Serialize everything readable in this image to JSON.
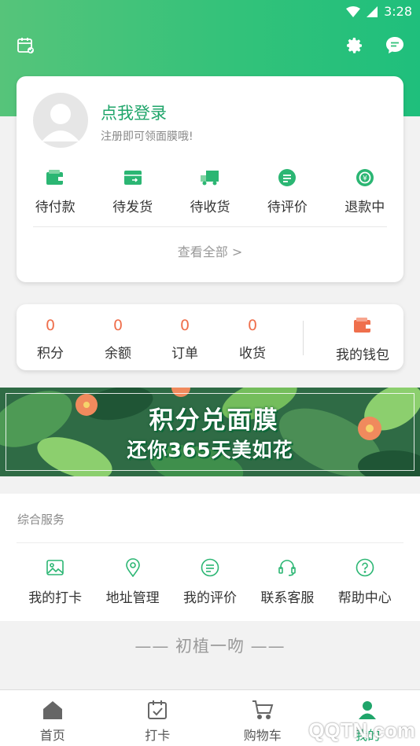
{
  "status_bar": {
    "time": "3:28"
  },
  "header": {
    "icons": [
      "calendar-check-icon",
      "settings-gear-icon",
      "message-bubble-icon"
    ],
    "gradient_colors": [
      "#56c47a",
      "#1fbf7c"
    ]
  },
  "profile": {
    "login_title": "点我登录",
    "login_subtitle": "注册即可领面膜哦!"
  },
  "orders": {
    "items": [
      {
        "label": "待付款",
        "icon": "wallet-icon"
      },
      {
        "label": "待发货",
        "icon": "shipping-box-icon"
      },
      {
        "label": "待收货",
        "icon": "truck-icon"
      },
      {
        "label": "待评价",
        "icon": "comment-icon"
      },
      {
        "label": "退款中",
        "icon": "refund-icon"
      }
    ],
    "view_all": "查看全部 >"
  },
  "stats": {
    "items": [
      {
        "value": "0",
        "label": "积分"
      },
      {
        "value": "0",
        "label": "余额"
      },
      {
        "value": "0",
        "label": "订单"
      },
      {
        "value": "0",
        "label": "收货"
      }
    ],
    "wallet_label": "我的钱包",
    "accent": "#ef6f4c"
  },
  "banner": {
    "title": "积分兑面膜",
    "subtitle": "还你365天美如花"
  },
  "services": {
    "title": "综合服务",
    "items": [
      {
        "label": "我的打卡",
        "icon": "image-icon"
      },
      {
        "label": "地址管理",
        "icon": "location-pin-icon"
      },
      {
        "label": "我的评价",
        "icon": "comment-lines-icon"
      },
      {
        "label": "联系客服",
        "icon": "headset-icon"
      },
      {
        "label": "帮助中心",
        "icon": "help-circle-icon"
      }
    ]
  },
  "slogan": "——  初植一吻  ——",
  "tabbar": {
    "items": [
      {
        "label": "首页",
        "icon": "home-icon"
      },
      {
        "label": "打卡",
        "icon": "calendar-check-icon"
      },
      {
        "label": "购物车",
        "icon": "cart-icon"
      },
      {
        "label": "我的",
        "icon": "person-icon"
      }
    ]
  },
  "watermark": "QQTN.com",
  "colors": {
    "brand_green": "#1fa56a",
    "icon_green": "#2bb673"
  }
}
